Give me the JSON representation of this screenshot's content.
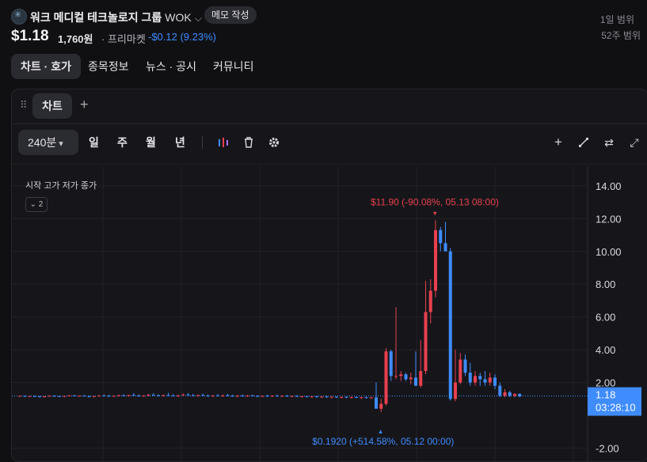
{
  "stock": {
    "name": "워크 메디컬 테크놀로지 그룹",
    "ticker": "WOK",
    "memo_label": "메모 작성",
    "price": "$1.18",
    "price_krw": "1,760원",
    "session": "· 프리마켓",
    "change": "-$0.12 (9.23%)",
    "range_1d_label": "1일 범위",
    "range_52w_label": "52주 범위"
  },
  "tabs": [
    "차트 · 호가",
    "종목정보",
    "뉴스 · 공시",
    "커뮤니티"
  ],
  "chart_tab": "차트",
  "toolbar": {
    "interval": "240분",
    "periods": [
      "일",
      "주",
      "월",
      "년"
    ],
    "icons": [
      "indicator-icon",
      "trash-icon",
      "settings-icon",
      "plus-icon",
      "draw-icon",
      "compare-icon",
      "fullscreen-icon"
    ]
  },
  "legend": {
    "text": "시작 고가 저가 종가",
    "collapsed_count": "2"
  },
  "colors": {
    "up": "#e8404f",
    "down": "#3f8cff",
    "bg": "#16161a"
  },
  "chart_data": {
    "type": "candlestick",
    "ylim": [
      -2.8,
      15.2
    ],
    "y_ticks": [
      "14.00",
      "12.00",
      "10.00",
      "8.00",
      "6.00",
      "4.00",
      "2.00",
      "-2.00"
    ],
    "last_price_label": "1.18",
    "last_time_label": "03:28:10",
    "last_price": 1.18,
    "high_annotation": "$11.90 (-90.08%, 05.13 08:00)",
    "low_annotation": "$0.1920 (+514.58%, 05.12 00:00)",
    "high_value": 11.9,
    "low_value": 0.192,
    "candles": [
      [
        1.17,
        1.2,
        1.14,
        1.18
      ],
      [
        1.18,
        1.21,
        1.15,
        1.16
      ],
      [
        1.16,
        1.19,
        1.12,
        1.17
      ],
      [
        1.17,
        1.21,
        1.14,
        1.15
      ],
      [
        1.15,
        1.18,
        1.1,
        1.12
      ],
      [
        1.12,
        1.17,
        1.08,
        1.16
      ],
      [
        1.16,
        1.22,
        1.13,
        1.19
      ],
      [
        1.19,
        1.23,
        1.15,
        1.17
      ],
      [
        1.17,
        1.2,
        1.12,
        1.14
      ],
      [
        1.14,
        1.19,
        1.1,
        1.18
      ],
      [
        1.18,
        1.24,
        1.15,
        1.21
      ],
      [
        1.21,
        1.25,
        1.16,
        1.17
      ],
      [
        1.17,
        1.22,
        1.13,
        1.2
      ],
      [
        1.2,
        1.23,
        1.15,
        1.16
      ],
      [
        1.16,
        1.2,
        1.11,
        1.13
      ],
      [
        1.13,
        1.18,
        1.09,
        1.17
      ],
      [
        1.17,
        1.23,
        1.14,
        1.21
      ],
      [
        1.21,
        1.27,
        1.17,
        1.19
      ],
      [
        1.19,
        1.24,
        1.14,
        1.16
      ],
      [
        1.16,
        1.21,
        1.12,
        1.19
      ],
      [
        1.19,
        1.26,
        1.15,
        1.22
      ],
      [
        1.22,
        1.28,
        1.17,
        1.18
      ],
      [
        1.18,
        1.25,
        1.14,
        1.24
      ],
      [
        1.24,
        1.35,
        1.18,
        1.2
      ],
      [
        1.2,
        1.27,
        1.15,
        1.17
      ],
      [
        1.17,
        1.22,
        1.12,
        1.21
      ],
      [
        1.21,
        1.3,
        1.17,
        1.26
      ],
      [
        1.26,
        1.34,
        1.2,
        1.22
      ],
      [
        1.22,
        1.28,
        1.16,
        1.18
      ],
      [
        1.18,
        1.26,
        1.14,
        1.23
      ],
      [
        1.23,
        1.37,
        1.18,
        1.21
      ],
      [
        1.21,
        1.29,
        1.15,
        1.17
      ],
      [
        1.17,
        1.24,
        1.12,
        1.22
      ],
      [
        1.22,
        1.33,
        1.17,
        1.27
      ],
      [
        1.27,
        1.36,
        1.2,
        1.22
      ],
      [
        1.22,
        1.3,
        1.16,
        1.19
      ],
      [
        1.19,
        1.25,
        1.13,
        1.24
      ],
      [
        1.24,
        1.32,
        1.18,
        1.2
      ],
      [
        1.2,
        1.27,
        1.14,
        1.17
      ],
      [
        1.17,
        1.23,
        1.11,
        1.21
      ],
      [
        1.21,
        1.29,
        1.15,
        1.18
      ],
      [
        1.18,
        1.25,
        1.12,
        1.22
      ],
      [
        1.22,
        1.3,
        1.16,
        1.19
      ],
      [
        1.19,
        1.26,
        1.13,
        1.16
      ],
      [
        1.16,
        1.22,
        1.1,
        1.2
      ],
      [
        1.2,
        1.28,
        1.14,
        1.17
      ],
      [
        1.17,
        1.24,
        1.12,
        1.21
      ],
      [
        1.21,
        1.27,
        1.15,
        1.18
      ],
      [
        1.18,
        1.23,
        1.12,
        1.15
      ],
      [
        1.15,
        1.21,
        1.1,
        1.19
      ],
      [
        1.19,
        1.26,
        1.13,
        1.16
      ],
      [
        1.16,
        1.22,
        1.11,
        1.2
      ],
      [
        1.2,
        1.26,
        1.14,
        1.17
      ],
      [
        1.17,
        1.22,
        1.12,
        1.19
      ],
      [
        1.19,
        1.24,
        1.13,
        1.15
      ],
      [
        1.15,
        1.2,
        1.1,
        1.18
      ],
      [
        1.18,
        1.23,
        1.12,
        1.14
      ],
      [
        1.14,
        1.19,
        1.08,
        1.16
      ],
      [
        1.16,
        1.21,
        1.1,
        1.13
      ],
      [
        1.13,
        1.18,
        1.07,
        1.15
      ],
      [
        1.15,
        1.2,
        1.09,
        1.12
      ],
      [
        1.12,
        1.17,
        1.06,
        1.14
      ],
      [
        1.14,
        1.19,
        1.08,
        1.1
      ],
      [
        1.1,
        1.16,
        1.04,
        1.13
      ],
      [
        1.13,
        1.17,
        1.06,
        1.09
      ],
      [
        1.09,
        1.15,
        1.03,
        1.12
      ],
      [
        1.12,
        1.16,
        1.05,
        1.08
      ],
      [
        1.08,
        1.14,
        1.02,
        1.11
      ],
      [
        1.11,
        1.16,
        1.05,
        1.07
      ],
      [
        1.07,
        1.13,
        1.0,
        1.1
      ],
      [
        1.1,
        1.14,
        1.02,
        1.06
      ],
      [
        1.06,
        1.12,
        1.0,
        1.09
      ],
      [
        1.09,
        2.0,
        0.95,
        0.4
      ],
      [
        0.4,
        1.0,
        0.192,
        0.7
      ],
      [
        0.7,
        4.1,
        0.6,
        3.9
      ],
      [
        3.9,
        4.0,
        2.1,
        2.4
      ],
      [
        2.4,
        6.6,
        2.2,
        2.4
      ],
      [
        2.4,
        2.7,
        2.1,
        2.5
      ],
      [
        2.5,
        2.6,
        2.1,
        2.2
      ],
      [
        2.2,
        2.6,
        1.9,
        2.3
      ],
      [
        2.3,
        3.9,
        2.0,
        1.8
      ],
      [
        1.8,
        4.6,
        1.7,
        2.7
      ],
      [
        2.7,
        8.2,
        2.5,
        6.3
      ],
      [
        6.3,
        8.3,
        5.6,
        7.6
      ],
      [
        7.6,
        11.9,
        7.2,
        11.3
      ],
      [
        11.3,
        11.5,
        10.0,
        10.5
      ],
      [
        10.5,
        11.8,
        10.0,
        10.0
      ],
      [
        10.0,
        10.2,
        0.9,
        1.0
      ],
      [
        1.0,
        4.0,
        0.85,
        2.0
      ],
      [
        2.0,
        3.8,
        1.9,
        3.4
      ],
      [
        3.4,
        3.7,
        2.4,
        2.6
      ],
      [
        2.6,
        3.2,
        1.8,
        2.0
      ],
      [
        2.0,
        2.7,
        1.8,
        2.4
      ],
      [
        2.4,
        2.6,
        1.8,
        2.2
      ],
      [
        2.2,
        2.7,
        1.8,
        2.0
      ],
      [
        2.0,
        2.6,
        1.8,
        2.3
      ],
      [
        2.3,
        2.5,
        1.6,
        1.8
      ],
      [
        1.8,
        2.0,
        1.1,
        1.2
      ],
      [
        1.2,
        1.6,
        1.1,
        1.4
      ],
      [
        1.4,
        1.5,
        1.1,
        1.2
      ],
      [
        1.2,
        1.35,
        1.1,
        1.3
      ],
      [
        1.3,
        1.35,
        1.1,
        1.15
      ]
    ]
  }
}
